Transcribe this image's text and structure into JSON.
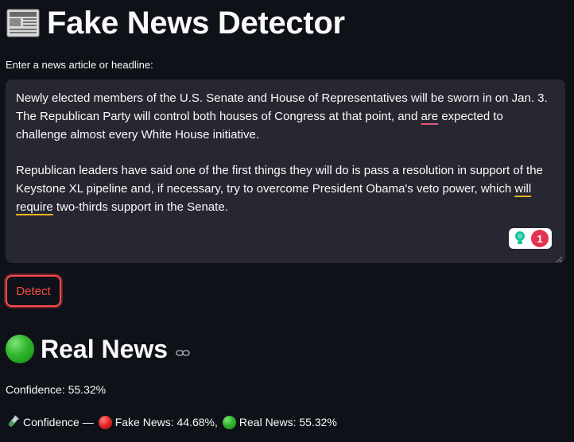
{
  "header": {
    "icon": "newspaper-icon",
    "title": "Fake News Detector"
  },
  "input": {
    "label": "Enter a news article or headline:",
    "paragraph1": {
      "part1": "Newly elected members of the U.S. Senate and House of Representatives will be sworn in on Jan. 3. The Republican Party will control both houses of Congress at that point, and ",
      "flagged": "are",
      "part2": " expected to challenge almost every White House initiative."
    },
    "paragraph2": {
      "part1": "Republican leaders have said one of the first things they will do is pass a resolution in support of the Keystone XL pipeline and, if necessary, try to overcome President Obama's veto power, which ",
      "flagged": "will require",
      "part2": " two-thirds support in the Senate."
    },
    "grammar_widget": {
      "icon": "lightbulb-icon",
      "count": "1"
    }
  },
  "actions": {
    "detect_label": "Detect"
  },
  "result": {
    "indicator_icon": "green-circle-icon",
    "heading": "Real News",
    "link_icon": "link-icon",
    "confidence_text": "Confidence: 55.32%",
    "breakdown": {
      "icon": "test-tube-icon",
      "prefix": "Confidence —",
      "fake_icon": "red-circle-icon",
      "fake_text": "Fake News: 44.68%,",
      "real_icon": "green-circle-icon",
      "real_text": "Real News: 55.32%"
    }
  },
  "colors": {
    "background": "#0e1117",
    "input_bg": "#262730",
    "accent": "#ff4b4b",
    "text": "#fafafa"
  }
}
